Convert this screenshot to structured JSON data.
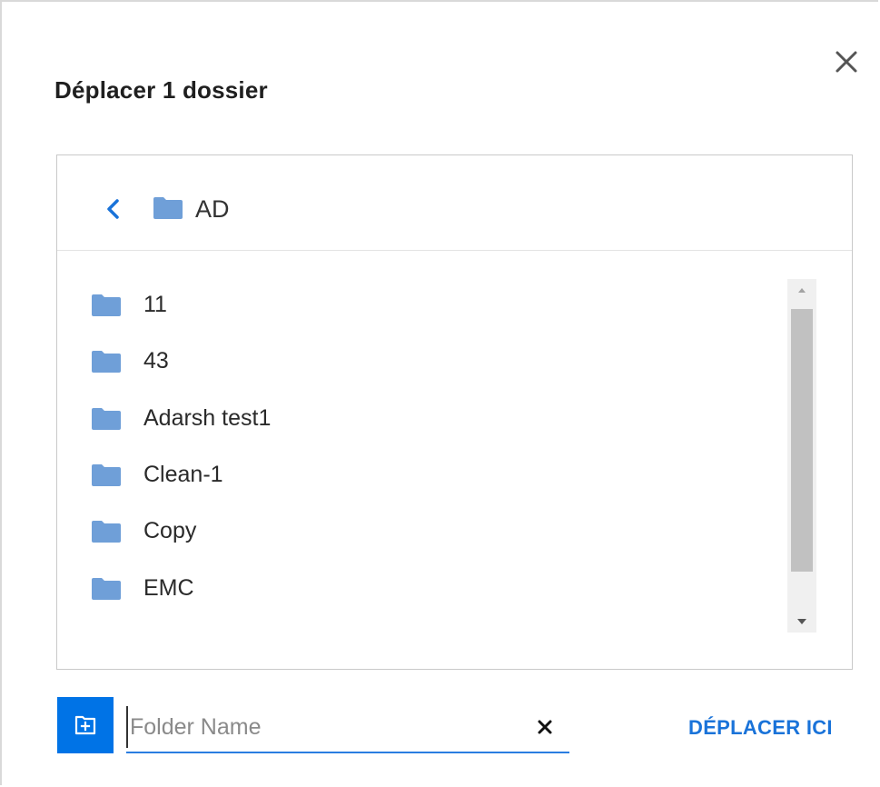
{
  "dialog": {
    "title": "Déplacer 1 dossier",
    "close_icon": "close-icon"
  },
  "browser": {
    "current_folder": "AD",
    "back_icon": "chevron-left-icon",
    "folders": [
      {
        "name": "11"
      },
      {
        "name": "43"
      },
      {
        "name": "Adarsh test1"
      },
      {
        "name": "Clean-1"
      },
      {
        "name": "Copy"
      },
      {
        "name": "EMC"
      }
    ]
  },
  "footer": {
    "new_folder_icon": "new-folder-icon",
    "folder_name_placeholder": "Folder Name",
    "folder_name_value": "",
    "clear_icon": "clear-icon",
    "move_here_label": "DÉPLACER ICI"
  },
  "colors": {
    "accent": "#0073e6",
    "link": "#1a73d9",
    "folder": "#6f9fd8"
  }
}
